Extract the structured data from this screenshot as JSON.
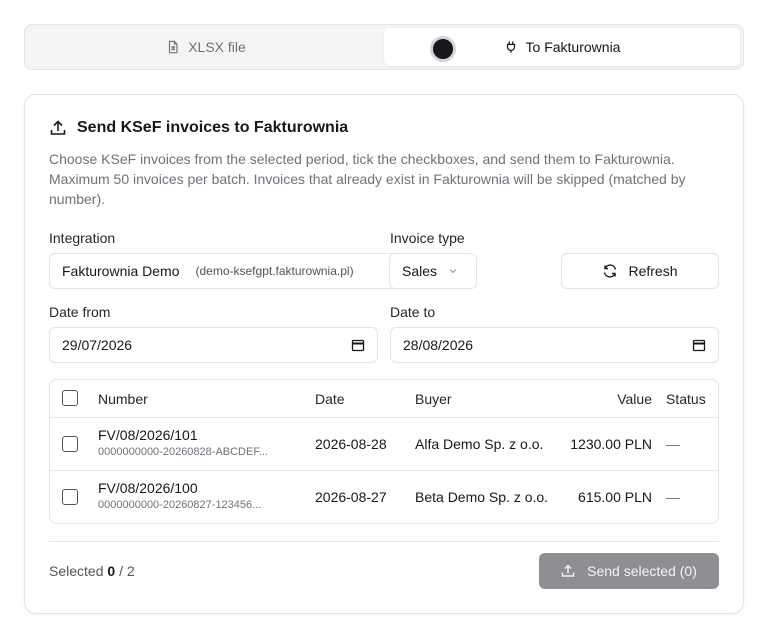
{
  "tabs": [
    {
      "label": "XLSX file",
      "icon": "file-spreadsheet-icon",
      "active": false
    },
    {
      "label": "To Fakturownia",
      "icon": "plug-icon",
      "active": true
    }
  ],
  "card": {
    "title": "Send KSeF invoices to Fakturownia",
    "description": "Choose KSeF invoices from the selected period, tick the checkboxes, and send them to Fakturownia. Maximum 50 invoices per batch. Invoices that already exist in Fakturownia will be skipped (matched by number)."
  },
  "form": {
    "integration_label": "Integration",
    "integration_value": "Fakturownia Demo",
    "integration_sub": "(demo-ksefgpt.fakturownia.pl)",
    "type_label": "Invoice type",
    "type_value": "Sales",
    "refresh_label": "Refresh",
    "date_from_label": "Date from",
    "date_from_value": "29/07/2026",
    "date_to_label": "Date to",
    "date_to_value": "28/08/2026"
  },
  "table": {
    "columns": [
      "Number",
      "Date",
      "Buyer",
      "Value",
      "Status"
    ],
    "rows": [
      {
        "number": "FV/08/2026/101",
        "ksef": "0000000000-20260828-ABCDEF...",
        "date": "2026-08-28",
        "buyer": "Alfa Demo Sp. z o.o.",
        "value": "1230.00 PLN",
        "status": "—"
      },
      {
        "number": "FV/08/2026/100",
        "ksef": "0000000000-20260827-123456...",
        "date": "2026-08-27",
        "buyer": "Beta Demo Sp. z o.o.",
        "value": "615.00 PLN",
        "status": "—"
      }
    ]
  },
  "footer": {
    "selected_prefix": "Selected",
    "selected_count": "0",
    "selected_sep": "/",
    "selected_total": "2",
    "send_label": "Send selected (0)"
  }
}
